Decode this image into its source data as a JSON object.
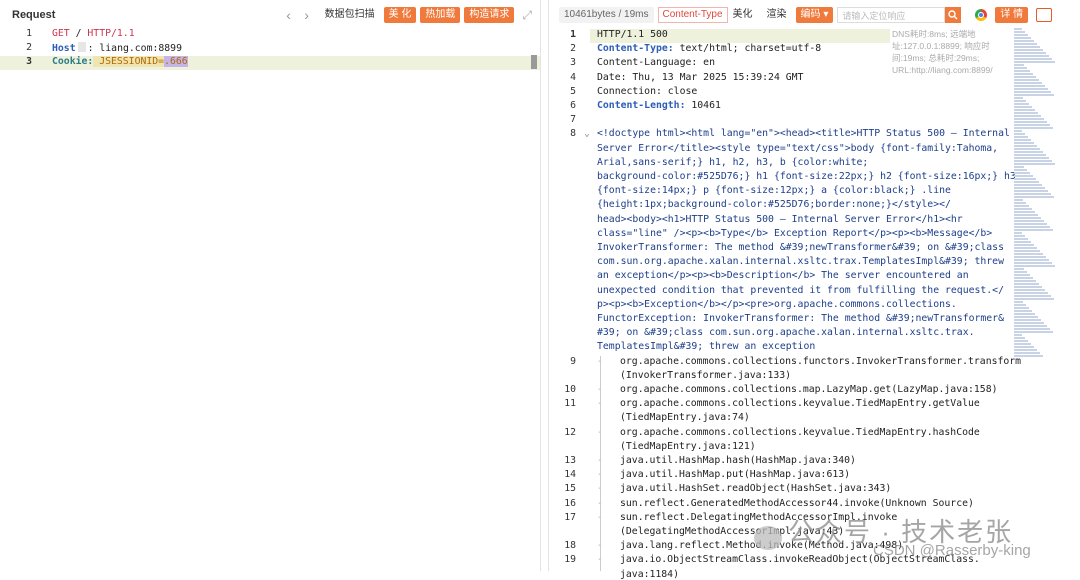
{
  "request": {
    "title": "Request",
    "buttons": {
      "scan": "数据包扫描",
      "beautify": "美 化",
      "hotload": "热加载",
      "construct": "构造请求"
    },
    "lines": [
      {
        "n": "1",
        "method": "GET",
        "sp1": " / ",
        "proto": "HTTP/1.1"
      },
      {
        "n": "2",
        "key": "Host",
        "rest": ": liang.com:8899"
      },
      {
        "n": "3",
        "key": "Cookie:",
        "cookie_name": " JSESSIONID=",
        "cookie_val": ".666"
      }
    ]
  },
  "response": {
    "size_info": "10461bytes / 19ms",
    "content_type_tag": "Content-Type",
    "buttons": {
      "beautify": "美化",
      "render": "渲染",
      "encoding": "编码 ▾",
      "details": "详 情"
    },
    "search_placeholder": "请输入定位响应",
    "meta_text": "DNS耗时:8ms; 远端地址:127.0.0.1:8899; 响应时间:19ms; 总耗时:29ms; URL:http://liang.com:8899/",
    "header_lines": [
      {
        "n": "1",
        "text": "HTTP/1.1 500"
      },
      {
        "n": "2",
        "key": "Content-Type:",
        "val": " text/html; charset=utf-8"
      },
      {
        "n": "3",
        "text": "Content-Language: en"
      },
      {
        "n": "4",
        "text": "Date: Thu, 13 Mar 2025 15:39:24 GMT"
      },
      {
        "n": "5",
        "text": "Connection: close"
      },
      {
        "n": "6",
        "key": "Content-Length:",
        "val": " 10461"
      }
    ],
    "body_start_n": "8",
    "body_lines": [
      "<!doctype html><html lang=\"en\"><head><title>HTTP Status 500 – Internal",
      "Server Error</title><style type=\"text/css\">body {font-family:Tahoma,",
      "Arial,sans-serif;} h1, h2, h3, b {color:white;",
      "background-color:#525D76;} h1 {font-size:22px;} h2 {font-size:16px;} h3",
      "{font-size:14px;} p {font-size:12px;} a {color:black;} .line",
      "{height:1px;background-color:#525D76;border:none;}</style></",
      "head><body><h1>HTTP Status 500 – Internal Server Error</h1><hr",
      "class=\"line\" /><p><b>Type</b> Exception Report</p><p><b>Message</b>",
      "InvokerTransformer: The method &#39;newTransformer&#39; on &#39;class",
      "com.sun.org.apache.xalan.internal.xsltc.trax.TemplatesImpl&#39; threw",
      "an exception</p><p><b>Description</b> The server encountered an",
      "unexpected condition that prevented it from fulfilling the request.</",
      "p><p><b>Exception</b></p><pre>org.apache.commons.collections.",
      "FunctorException: InvokerTransformer: The method &#39;newTransformer&",
      "#39; on &#39;class com.sun.org.apache.xalan.internal.xsltc.trax.",
      "TemplatesImpl&#39; threw an exception"
    ],
    "stack_lines": [
      {
        "n": "9",
        "l1": "org.apache.commons.collections.functors.InvokerTransformer.transform",
        "l2": "(InvokerTransformer.java:133)"
      },
      {
        "n": "10",
        "l1": "org.apache.commons.collections.map.LazyMap.get(LazyMap.java:158)"
      },
      {
        "n": "11",
        "l1": "org.apache.commons.collections.keyvalue.TiedMapEntry.getValue",
        "l2": "(TiedMapEntry.java:74)"
      },
      {
        "n": "12",
        "l1": "org.apache.commons.collections.keyvalue.TiedMapEntry.hashCode",
        "l2": "(TiedMapEntry.java:121)"
      },
      {
        "n": "13",
        "l1": "java.util.HashMap.hash(HashMap.java:340)"
      },
      {
        "n": "14",
        "l1": "java.util.HashMap.put(HashMap.java:613)"
      },
      {
        "n": "15",
        "l1": "java.util.HashSet.readObject(HashSet.java:343)"
      },
      {
        "n": "16",
        "l1": "sun.reflect.GeneratedMethodAccessor44.invoke(Unknown Source)"
      },
      {
        "n": "17",
        "l1": "sun.reflect.DelegatingMethodAccessorImpl.invoke",
        "l2": "(DelegatingMethodAccessorImpl.java:43)"
      },
      {
        "n": "18",
        "l1": "java.lang.reflect.Method.invoke(Method.java:498)"
      },
      {
        "n": "19",
        "l1": "java.io.ObjectStreamClass.invokeReadObject(ObjectStreamClass.",
        "l2": "java:1184)"
      }
    ]
  },
  "watermark": {
    "line1": "公众号 · 技术老张",
    "line2": "CSDN @Rasserby-king"
  },
  "icons": {
    "nav_prev": "chevron-left-icon",
    "nav_next": "chevron-right-icon",
    "expand": "expand-icon",
    "search": "search-icon",
    "browser": "chrome-icon",
    "chat": "chat-icon",
    "fold": "chevron-down-icon"
  },
  "colors": {
    "accent": "#f07a3c",
    "keyword_red": "#d2314e",
    "keyword_blue": "#2b5db8",
    "highlight_row": "#eef2dc"
  }
}
